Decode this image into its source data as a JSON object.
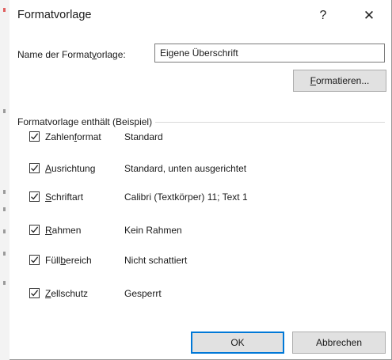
{
  "dialog": {
    "title": "Formatvorlage",
    "help_label": "?",
    "close_label": "✕"
  },
  "name_field": {
    "label_pre": "Name der Format",
    "label_accel": "v",
    "label_post": "orlage:",
    "value": "Eigene Überschrift"
  },
  "format_button": {
    "accel": "F",
    "rest": "ormatieren..."
  },
  "group": {
    "legend": "Formatvorlage enthält (Beispiel)",
    "items": [
      {
        "pre": "Zahlen",
        "accel": "f",
        "post": "ormat",
        "value": "Standard",
        "checked": true
      },
      {
        "pre": "",
        "accel": "A",
        "post": "usrichtung",
        "value": "Standard, unten ausgerichtet",
        "checked": true
      },
      {
        "pre": "",
        "accel": "S",
        "post": "chriftart",
        "value": "Calibri (Textkörper) 11; Text 1",
        "checked": true
      },
      {
        "pre": "",
        "accel": "R",
        "post": "ahmen",
        "value": "Kein Rahmen",
        "checked": true
      },
      {
        "pre": "Füll",
        "accel": "b",
        "post": "ereich",
        "value": "Nicht schattiert",
        "checked": true
      },
      {
        "pre": "",
        "accel": "Z",
        "post": "ellschutz",
        "value": "Gesperrt",
        "checked": true
      }
    ]
  },
  "buttons": {
    "ok": "OK",
    "cancel": "Abbrechen"
  },
  "colors": {
    "accent": "#0078d7",
    "button_bg": "#e1e1e1"
  }
}
